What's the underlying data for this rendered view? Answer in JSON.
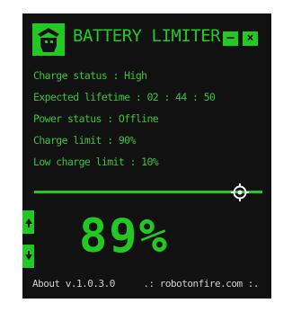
{
  "window": {
    "title": "BATTERY LIMITER",
    "minimize_label": "–",
    "close_label": "×"
  },
  "status": {
    "charge_status": "Charge status : High",
    "expected_lifetime": "Expected lifetime : 02 : 44 : 50",
    "power_status": "Power status : Offline",
    "charge_limit": "Charge limit : 90%",
    "low_charge_limit": "Low charge limit : 10%"
  },
  "limit_slider": {
    "value_percent": 90
  },
  "battery": {
    "percent_label": "89%"
  },
  "footer": {
    "about": "About v.1.0.3.0",
    "site": ".: robotonfire.com :."
  },
  "colors": {
    "background": "#111111",
    "accent": "#22c922",
    "text": "#3cc33c",
    "footer_text": "#cfcfcf"
  },
  "icons": {
    "logo": "robot-logo-icon",
    "side_tab_1": "up-arrow-icon",
    "side_tab_2": "down-arrow-icon"
  }
}
